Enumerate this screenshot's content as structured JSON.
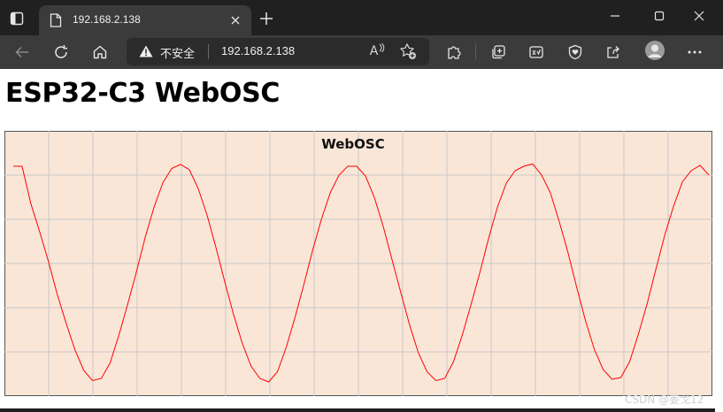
{
  "browser": {
    "tab_title": "192.168.2.138",
    "insecure_label": "不安全",
    "url": "192.168.2.138",
    "read_aloud_label": "A",
    "icons": {
      "tab_actions": "tab-actions-icon",
      "favicon": "page-icon",
      "tab_close": "close-icon",
      "new_tab": "plus-icon",
      "minimize": "minimize-icon",
      "maximize": "maximize-icon",
      "window_close": "close-icon",
      "back": "arrow-left-icon",
      "refresh": "refresh-icon",
      "home": "home-icon",
      "warning": "warning-icon",
      "read_aloud": "read-aloud-icon",
      "add_favorite": "star-plus-icon",
      "extensions": "puzzle-icon",
      "collections": "collections-icon",
      "math_solver": "math-solver-icon",
      "browser_essentials": "shield-heart-icon",
      "share": "share-icon",
      "profile": "avatar-icon",
      "more": "more-icon"
    }
  },
  "page": {
    "title": "ESP32-C3 WebOSC",
    "watermark": "CSDN @姜戈12"
  },
  "chart_data": {
    "type": "line",
    "title": "WebOSC",
    "xlabel": "",
    "ylabel": "",
    "xlim": [
      0,
      80
    ],
    "ylim": [
      0,
      6
    ],
    "grid": true,
    "background": "#fae6d7",
    "grid_color": "#c8c8c8",
    "line_color": "#ff0000",
    "series": [
      {
        "x": [
          0,
          1,
          2,
          3,
          4,
          5,
          6,
          7,
          8,
          9,
          10,
          11,
          12,
          13,
          14,
          15,
          16,
          17,
          18,
          19,
          20,
          21,
          22,
          23,
          24,
          25,
          26,
          27,
          28,
          29,
          30,
          31,
          32,
          33,
          34,
          35,
          36,
          37,
          38,
          39,
          40,
          41,
          42,
          43,
          44,
          45,
          46,
          47,
          48,
          49,
          50,
          51,
          52,
          53,
          54,
          55,
          56,
          57,
          58,
          59,
          60,
          61,
          62,
          63,
          64,
          65,
          66,
          67,
          68,
          69,
          70,
          71,
          72,
          73,
          74,
          75,
          76,
          77,
          78,
          79
        ],
        "y": [
          5.2,
          5.2,
          4.35,
          3.72,
          3.04,
          2.3,
          1.65,
          1.05,
          0.58,
          0.35,
          0.4,
          0.75,
          1.38,
          2.08,
          2.82,
          3.6,
          4.28,
          4.83,
          5.15,
          5.24,
          5.12,
          4.7,
          4.1,
          3.38,
          2.6,
          1.86,
          1.2,
          0.68,
          0.4,
          0.32,
          0.55,
          1.1,
          1.78,
          2.52,
          3.3,
          4.0,
          4.6,
          5.0,
          5.2,
          5.2,
          4.98,
          4.5,
          3.85,
          3.1,
          2.35,
          1.62,
          0.98,
          0.55,
          0.35,
          0.4,
          0.78,
          1.38,
          2.08,
          2.8,
          3.58,
          4.28,
          4.82,
          5.1,
          5.2,
          5.25,
          5.0,
          4.6,
          3.95,
          3.25,
          2.45,
          1.7,
          1.05,
          0.6,
          0.38,
          0.42,
          0.78,
          1.4,
          2.1,
          2.88,
          3.65,
          4.3,
          4.85,
          5.1,
          5.22,
          5.0
        ]
      }
    ]
  }
}
